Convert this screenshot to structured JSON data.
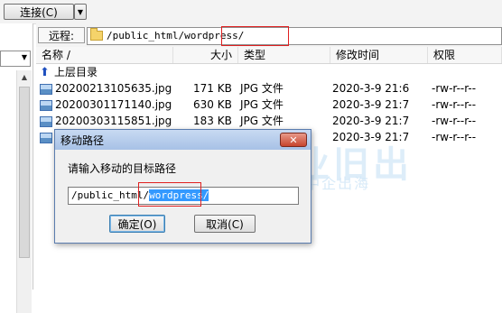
{
  "toolbar": {
    "connect_label": "连接(C)",
    "connect_dropdown": "▼"
  },
  "left_pane": {
    "dropdown_arrow": "▼",
    "scroll_up": "▲",
    "scroll_down": "▼"
  },
  "remote": {
    "label": "远程:",
    "path": "/public_html/wordpress/"
  },
  "columns": {
    "name": "名称 /",
    "size": "大小",
    "type": "类型",
    "modified": "修改时间",
    "perms": "权限"
  },
  "files": [
    {
      "name": "上层目录",
      "size": "",
      "type": "",
      "modified": "",
      "perms": "",
      "icon": "up-folder-icon"
    },
    {
      "name": "20200213105635.jpg",
      "size": "171 KB",
      "type": "JPG 文件",
      "modified": "2020-3-9 21:6",
      "perms": "-rw-r--r--",
      "icon": "jpg-file-icon"
    },
    {
      "name": "20200301171140.jpg",
      "size": "630 KB",
      "type": "JPG 文件",
      "modified": "2020-3-9 21:7",
      "perms": "-rw-r--r--",
      "icon": "jpg-file-icon"
    },
    {
      "name": "20200303115851.jpg",
      "size": "183 KB",
      "type": "JPG 文件",
      "modified": "2020-3-9 21:7",
      "perms": "-rw-r--r--",
      "icon": "jpg-file-icon"
    },
    {
      "name": "",
      "size": "",
      "type": "JPG 文件",
      "modified": "2020-3-9 21:7",
      "perms": "-rw-r--r--",
      "icon": "jpg-file-icon"
    }
  ],
  "dialog": {
    "title": "移动路径",
    "close": "✕",
    "prompt": "请输入移动的目标路径",
    "input_prefix": "/public_html/",
    "input_selected": "wordpress/",
    "ok_label": "确定(O)",
    "cancel_label": "取消(C)"
  },
  "watermark": {
    "big": "业旧出",
    "small": "服务跨境电商 助力中企出海"
  }
}
